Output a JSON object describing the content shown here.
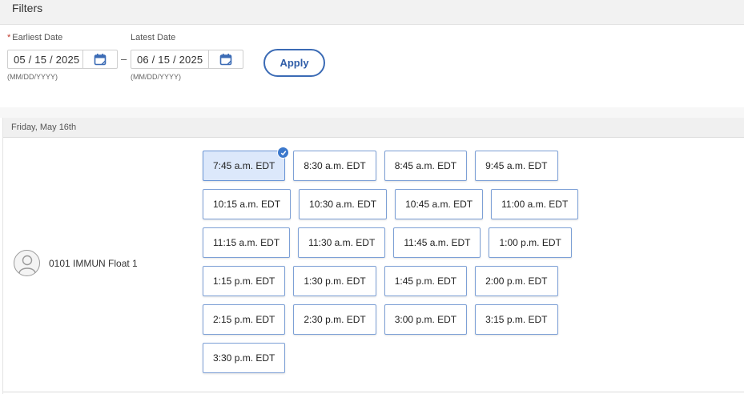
{
  "filters": {
    "title": "Filters",
    "earliest": {
      "required_mark": "*",
      "label": "Earliest Date",
      "value": "05 / 15 / 2025",
      "format_hint": "(MM/DD/YYYY)"
    },
    "range_separator": "–",
    "latest": {
      "label": "Latest Date",
      "value": "06 / 15 / 2025",
      "format_hint": "(MM/DD/YYYY)"
    },
    "apply_label": "Apply",
    "calendar_icon": "calendar-icon"
  },
  "day": {
    "header": "Friday, May 16th",
    "provider": {
      "name": "0101 IMMUN Float 1",
      "avatar_icon": "user-avatar-icon"
    },
    "selected_slot": "7:45 a.m. EDT",
    "slot_rows": [
      [
        "7:45 a.m. EDT",
        "8:30 a.m. EDT",
        "8:45 a.m. EDT",
        "9:45 a.m. EDT"
      ],
      [
        "10:15 a.m. EDT",
        "10:30 a.m. EDT",
        "10:45 a.m. EDT",
        "11:00 a.m. EDT"
      ],
      [
        "11:15 a.m. EDT",
        "11:30 a.m. EDT",
        "11:45 a.m. EDT",
        "1:00 p.m. EDT"
      ],
      [
        "1:15 p.m. EDT",
        "1:30 p.m. EDT",
        "1:45 p.m. EDT",
        "2:00 p.m. EDT"
      ],
      [
        "2:15 p.m. EDT",
        "2:30 p.m. EDT",
        "3:00 p.m. EDT",
        "3:15 p.m. EDT"
      ],
      [
        "3:30 p.m. EDT"
      ]
    ]
  },
  "colors": {
    "accent": "#3b6bb5",
    "selected_bg": "#dce8fb",
    "slot_border": "#7da0d6"
  }
}
